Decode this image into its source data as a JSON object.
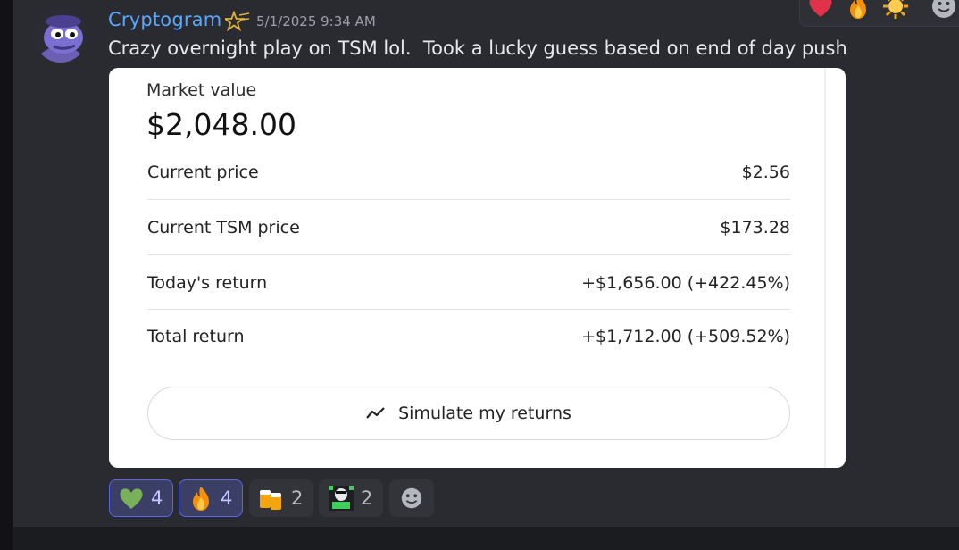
{
  "message": {
    "username": "Cryptogram",
    "timestamp": "5/1/2025 9:34 AM",
    "text": "Crazy overnight play on TSM lol.  Took a lucky guess based on end of day push",
    "avatar_icon": "pepe-avatar"
  },
  "hover_bar": {
    "icons": [
      "heart-icon",
      "fire-icon",
      "sun-icon",
      "add-reaction-icon"
    ]
  },
  "card": {
    "market_value_label": "Market value",
    "market_value": "$2,048.00",
    "rows": [
      {
        "label": "Current price",
        "value": "$2.56"
      },
      {
        "label": "Current TSM price",
        "value": "$173.28"
      },
      {
        "label": "Today's return",
        "value": "+$1,656.00 (+422.45%)"
      },
      {
        "label": "Total return",
        "value": "+$1,712.00 (+509.52%)"
      }
    ],
    "simulate_label": "Simulate my returns",
    "simulate_icon": "trend-line-icon"
  },
  "reactions": [
    {
      "icon": "green-heart-icon",
      "count": "4",
      "active": true
    },
    {
      "icon": "fire-icon",
      "count": "4",
      "active": true
    },
    {
      "icon": "beer-mugs-icon",
      "count": "2",
      "active": false
    },
    {
      "icon": "custom-emote-icon",
      "count": "2",
      "active": false
    }
  ],
  "add_reaction_icon": "add-reaction-icon",
  "colors": {
    "background": "#2a2b31",
    "username": "#5aa7ff",
    "active_reaction_bg": "#3b3f66",
    "active_reaction_border": "#5865f2"
  }
}
